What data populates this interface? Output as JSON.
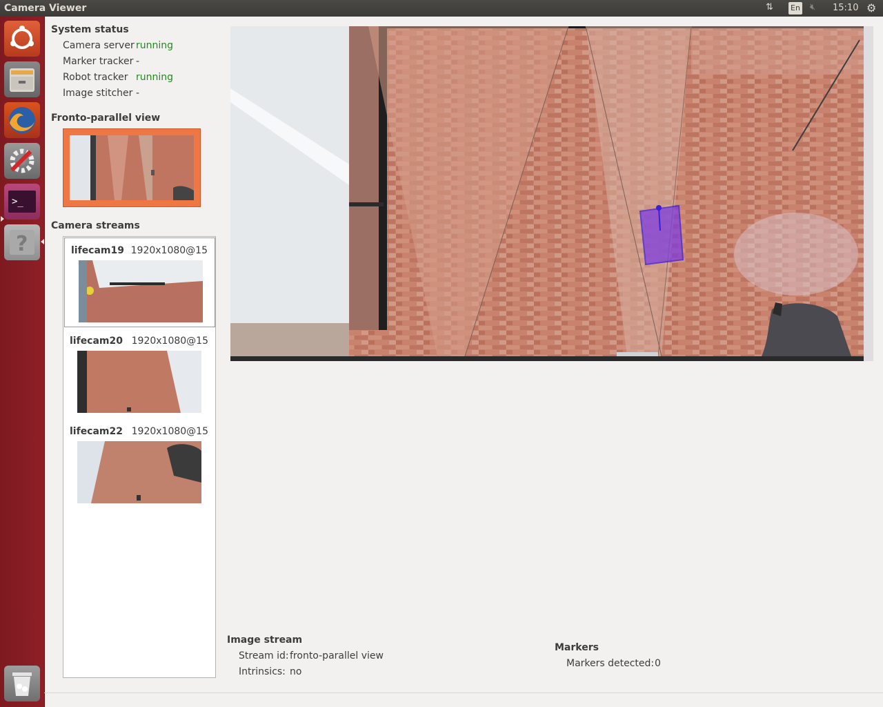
{
  "window": {
    "title": "Camera Viewer"
  },
  "tray": {
    "network_icon": "network-updown-icon",
    "language": "En",
    "volume_icon": "volume-muted-icon",
    "clock": "15:10",
    "settings_icon": "gear-icon"
  },
  "launcher": {
    "items": [
      "ubuntu-dash",
      "files",
      "firefox",
      "system-settings",
      "terminal",
      "help",
      "trash"
    ]
  },
  "system_status": {
    "heading": "System status",
    "rows": [
      {
        "label": "Camera server",
        "value": "running"
      },
      {
        "label": "Marker tracker",
        "value": "-"
      },
      {
        "label": "Robot tracker",
        "value": "running"
      },
      {
        "label": "Image stitcher",
        "value": "-"
      }
    ]
  },
  "fronto": {
    "heading": "Fronto-parallel view"
  },
  "streams": {
    "heading": "Camera streams",
    "items": [
      {
        "name": "lifecam19",
        "resolution": "1920x1080@15"
      },
      {
        "name": "lifecam20",
        "resolution": "1920x1080@15"
      },
      {
        "name": "lifecam22",
        "resolution": "1920x1080@15"
      }
    ]
  },
  "image_stream": {
    "heading": "Image stream",
    "stream_id_label": "Stream id:",
    "stream_id_value": "fronto-parallel view",
    "intrinsics_label": "Intrinsics:",
    "intrinsics_value": "no"
  },
  "markers": {
    "heading": "Markers",
    "detected_label": "Markers detected:",
    "detected_value": "0"
  },
  "colors": {
    "running": "#23891e",
    "accent": "#ee7744",
    "launcher": "#8f1f27",
    "robot_box": "#6a2ad8"
  }
}
